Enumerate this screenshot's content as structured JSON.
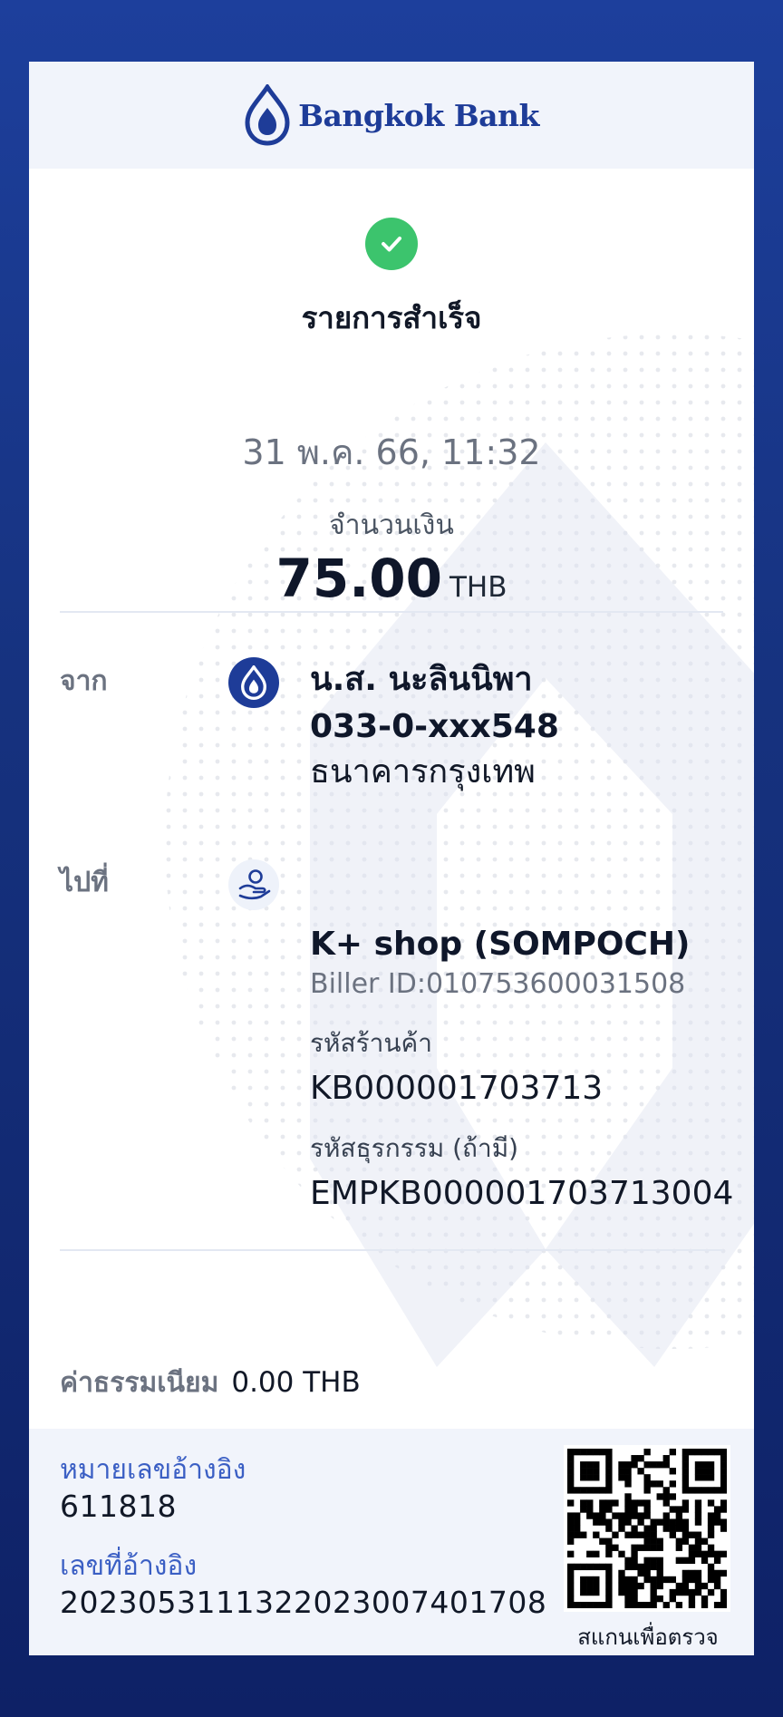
{
  "header": {
    "bank_name": "Bangkok Bank",
    "logo_icon": "lotus-icon"
  },
  "status": {
    "icon": "check-icon",
    "color": "#3cc46d",
    "text": "รายการสำเร็จ"
  },
  "datetime": "31 พ.ค. 66, 11:32",
  "amount": {
    "label": "จำนวนเงิน",
    "value": "75.00",
    "currency": "THB"
  },
  "from": {
    "label": "จาก",
    "icon": "bangkok-bank-icon",
    "name": "น.ส. นะลินนิพา",
    "account": "033-0-xxx548",
    "bank": "ธนาคารกรุงเทพ"
  },
  "to": {
    "label": "ไปที่",
    "icon": "biller-hand-icon",
    "name": "K+ shop (SOMPOCH)",
    "biller_id": "Biller ID:010753600031508",
    "store_code_label": "รหัสร้านค้า",
    "store_code": "KB000001703713",
    "txn_code_label": "รหัสธุรกรรม (ถ้ามี)",
    "txn_code": "EMPKB000001703713004"
  },
  "fee": {
    "label": "ค่าธรรมเนียม",
    "value": "0.00 THB"
  },
  "footer": {
    "ref1_label": "หมายเลขอ้างอิง",
    "ref1_value": "611818",
    "ref2_label": "เลขที่อ้างอิง",
    "ref2_value": "20230531113220230074017 08",
    "qr_icon": "qr-code-icon",
    "qr_caption": "สแกนเพื่อตรวจสอบ"
  },
  "colors": {
    "brand": "#1e3c98",
    "background": "#16327f",
    "success": "#3cc46d",
    "link": "#3b5fc4"
  }
}
